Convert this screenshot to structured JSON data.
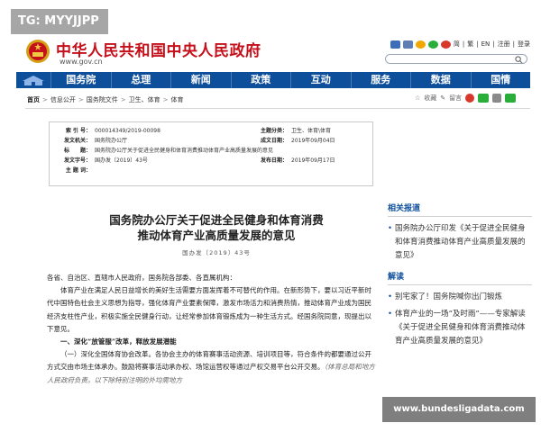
{
  "watermark_top": "TG: MYYJJPP",
  "watermark_bottom": "www.bundesligadata.com",
  "site": {
    "title": "中华人民共和国中央人民政府",
    "url": "www.gov.cn",
    "links": [
      "简",
      "繁",
      "EN",
      "注册",
      "登录"
    ]
  },
  "nav": [
    "国务院",
    "总理",
    "新闻",
    "政策",
    "互动",
    "服务",
    "数据",
    "国情"
  ],
  "breadcrumb": {
    "home": "首页",
    "items": [
      "信息公开",
      "国务院文件",
      "卫生、体育",
      "体育"
    ],
    "actions": [
      "收藏",
      "留言"
    ]
  },
  "meta": {
    "rows": [
      {
        "k1": "索 引 号：",
        "v1": "000014349/2019-00098",
        "k2": "主题分类：",
        "v2": "卫生、体育\\体育"
      },
      {
        "k1": "发文机关：",
        "v1": "国务院办公厅",
        "k2": "成文日期：",
        "v2": "2019年09月04日"
      },
      {
        "k1": "标　　题：",
        "v1": "国务院办公厅关于促进全民健身和体育消费推动体育产业高质量发展的意见",
        "k2": "",
        "v2": ""
      },
      {
        "k1": "发文字号：",
        "v1": "国办发〔2019〕43号",
        "k2": "发布日期：",
        "v2": "2019年09月17日"
      },
      {
        "k1": "主 题 词：",
        "v1": "",
        "k2": "",
        "v2": ""
      }
    ]
  },
  "document": {
    "title_line1": "国务院办公厅关于促进全民健身和体育消费",
    "title_line2": "推动体育产业高质量发展的意见",
    "number": "国办发〔2019〕43号",
    "salutation": "各省、自治区、直辖市人民政府，国务院各部委、各直属机构：",
    "para1": "体育产业在满足人民日益增长的美好生活需要方面发挥着不可替代的作用。在新形势下，要以习近平新时代中国特色社会主义思想为指导，强化体育产业要素保障，激发市场活力和消费热情，推动体育产业成为国民经济支柱性产业，积极实施全民健身行动，让经常参加体育锻炼成为一种生活方式。经国务院同意，现提出以下意见。",
    "section1": "一、深化“放管服”改革，释放发展潜能",
    "para2_head": "（一）深化全国体育协会改革。",
    "para2": "各协会主办的体育赛事活动资源、培训项目等，符合条件的都要通过公开方式交由市场主体承办。鼓励将赛事活动承办权、场馆运营权等通过产权交易平台公开交易。",
    "para2_tail": "（体育总局和地方人民政府负责。以下除特别注明的外均需地方"
  },
  "sidebar": {
    "related_title": "相关报道",
    "related": [
      "国务院办公厅印发《关于促进全民健身和体育消费推动体育产业高质量发展的意见》"
    ],
    "interp_title": "解读",
    "interp": [
      "别宅家了！国务院喊你出门锻炼",
      "体育产业的一场“及时雨”——专家解读《关于促进全民健身和体育消费推动体育产业高质量发展的意见》"
    ]
  },
  "colors": {
    "brand_red": "#c5101b",
    "nav_blue": "#0e4f9c"
  }
}
